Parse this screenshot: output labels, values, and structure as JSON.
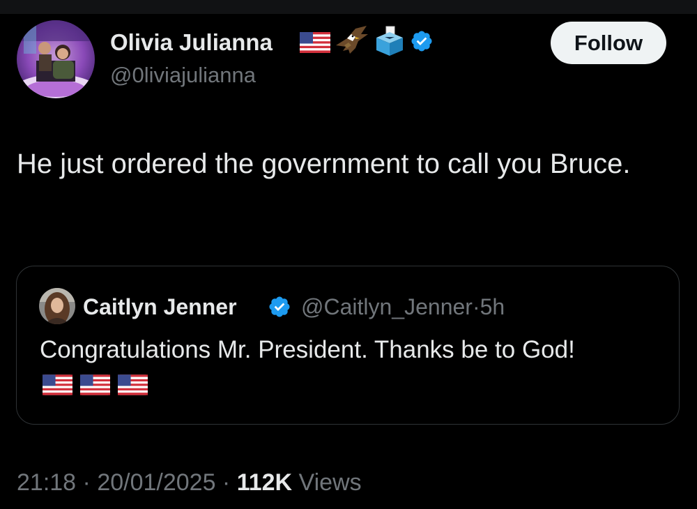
{
  "author": {
    "display_name": "Olivia Julianna",
    "handle": "@0liviajulianna",
    "name_emojis": [
      "us-flag-icon",
      "eagle-icon",
      "ballot-box-icon"
    ],
    "verified_color": "#1d9bf0"
  },
  "follow_label": "Follow",
  "tweet": {
    "text": "He just ordered the government to call you Bruce."
  },
  "quote": {
    "display_name": "Caitlyn Jenner",
    "handle": "@Caitlyn_Jenner",
    "separator": "·",
    "time": "5h",
    "text": "Congratulations Mr. President. Thanks be to God!",
    "emojis": [
      "us-flag-icon",
      "us-flag-icon",
      "us-flag-icon"
    ]
  },
  "meta": {
    "time": "21:18",
    "sep1": " · ",
    "date": "20/01/2025",
    "sep2": " · ",
    "views_count": "112K",
    "views_label": " Views"
  },
  "colors": {
    "background": "#000000",
    "text_primary": "#e7e9ea",
    "text_secondary": "#71767b",
    "border": "#2f3336",
    "follow_bg": "#eff3f4"
  }
}
